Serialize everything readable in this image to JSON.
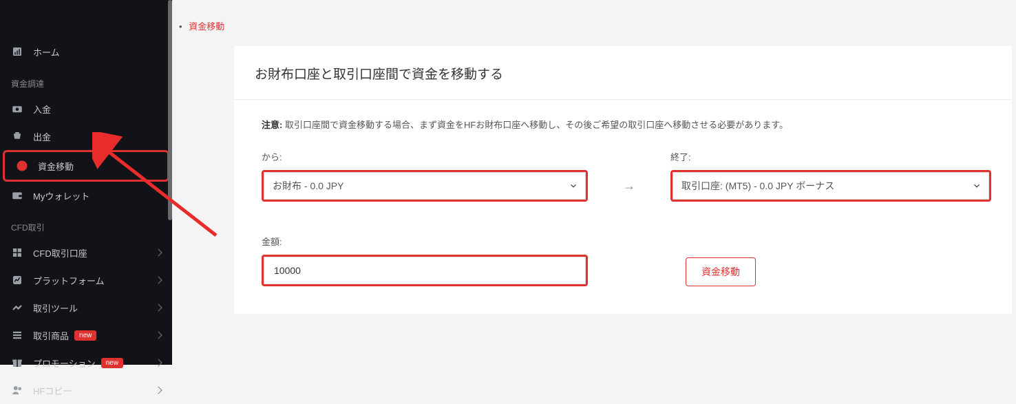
{
  "sidebar": {
    "home": "ホーム",
    "section_funding": "資金調達",
    "deposit": "入金",
    "withdraw": "出金",
    "transfer": "資金移動",
    "wallet": "Myウォレット",
    "section_cfd": "CFD取引",
    "cfd_account": "CFD取引口座",
    "platform": "プラットフォーム",
    "trading_tool": "取引ツール",
    "trading_product": "取引商品",
    "promotion": "プロモーション",
    "hfcopy": "HFコピー",
    "badge_new": "new"
  },
  "breadcrumb": {
    "current": "資金移動"
  },
  "card": {
    "title": "お財布口座と取引口座間で資金を移動する",
    "notice_label": "注意:",
    "notice_text": " 取引口座間で資金移動する場合、まず資金をHFお財布口座へ移動し、その後ご希望の取引口座へ移動させる必要があります。",
    "from_label": "から:",
    "to_label": "終了:",
    "from_option": "お財布 - 0.0 JPY",
    "to_option": "取引口座:               (MT5) - 0.0 JPY ボーナス",
    "amount_label": "金額:",
    "amount_value": "10000",
    "submit": "資金移動"
  }
}
